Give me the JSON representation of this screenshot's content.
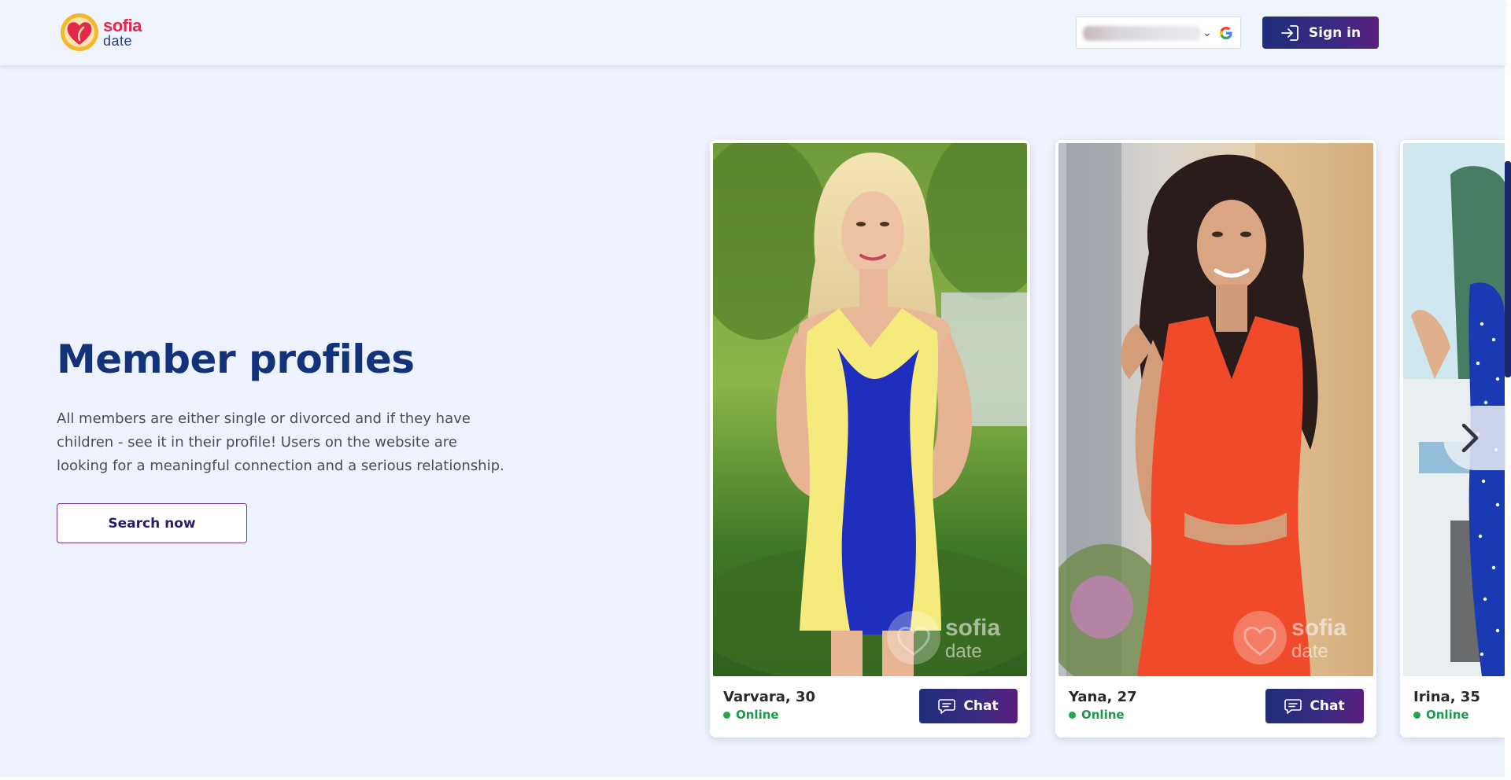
{
  "header": {
    "logo": {
      "line1": "sofia",
      "line2": "date"
    },
    "account_chip": {
      "icon": "google-icon"
    },
    "signin_label": "Sign in",
    "signin_icon": "sign-in-arrow-icon"
  },
  "hero": {
    "title": "Member profiles",
    "description": "All members are either single or divorced and if they have children - see it in their profile! Users on the website are looking for a meaningful connection and a serious relationship.",
    "search_label": "Search now"
  },
  "profiles": [
    {
      "name": "Varvara, 30",
      "status": "Online",
      "chat_label": "Chat",
      "watermark": {
        "line1": "sofia",
        "line2": "date"
      }
    },
    {
      "name": "Yana, 27",
      "status": "Online",
      "chat_label": "Chat",
      "watermark": {
        "line1": "sofia",
        "line2": "date"
      }
    },
    {
      "name": "Irina, 35",
      "status": "Online"
    }
  ],
  "carousel": {
    "next_icon": "chevron-right-icon"
  },
  "colors": {
    "brand_navy": "#12337a",
    "button_gradient_start": "#1f2f7a",
    "button_gradient_end": "#5a1f7e",
    "online_green": "#22a64e",
    "logo_red": "#e3284a",
    "page_bg": "#eef2fc"
  }
}
